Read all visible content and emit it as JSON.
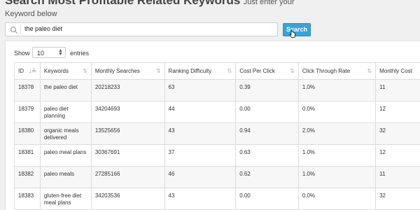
{
  "header": {
    "title": "Search Most Profitable Related Keywords",
    "subtitle_part1": "Just enter your",
    "subtitle_part2": "Keyword below"
  },
  "search": {
    "value": "the paleo diet",
    "button_label": "Search"
  },
  "table_controls": {
    "show_label": "Show",
    "entries_value": "10",
    "entries_label": "entries"
  },
  "columns": [
    "ID",
    "Keywords",
    "Monthly Searches",
    "Ranking Difficulty",
    "Cost Per Click",
    "Click Through Rate",
    "Monthly Cost"
  ],
  "rows": [
    {
      "id": "18378",
      "keyword": "the paleo diet",
      "searches": "20218233",
      "difficulty": "63",
      "cpc": "0.39",
      "ctr": "1.0%",
      "cost": "11"
    },
    {
      "id": "18379",
      "keyword": "paleo diet planning",
      "searches": "34204693",
      "difficulty": "44",
      "cpc": "0.00",
      "ctr": "0.0%",
      "cost": "12"
    },
    {
      "id": "18380",
      "keyword": "organic meals delivered",
      "searches": "13525656",
      "difficulty": "43",
      "cpc": "0.94",
      "ctr": "2.0%",
      "cost": "32"
    },
    {
      "id": "18381",
      "keyword": "paleo meal plans",
      "searches": "30367691",
      "difficulty": "37",
      "cpc": "0.63",
      "ctr": "1.0%",
      "cost": "12"
    },
    {
      "id": "18382",
      "keyword": "paleo meals",
      "searches": "27285166",
      "difficulty": "46",
      "cpc": "0.62",
      "ctr": "1.0%",
      "cost": "11"
    },
    {
      "id": "18383",
      "keyword": "gluten-free diet meal plans",
      "searches": "34203536",
      "difficulty": "43",
      "cpc": "0.00",
      "ctr": "0.0%",
      "cost": "32"
    }
  ]
}
